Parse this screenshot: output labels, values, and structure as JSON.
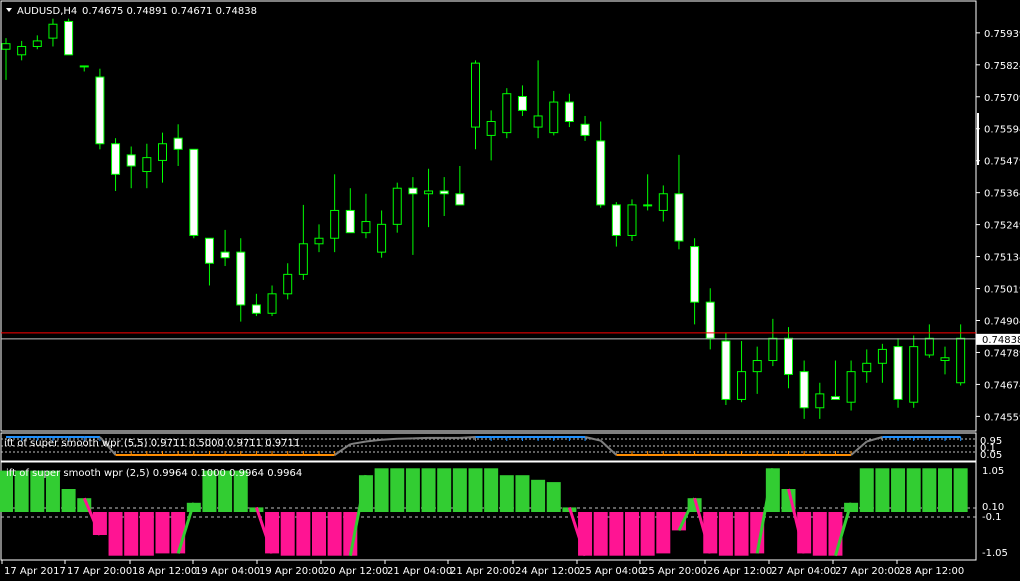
{
  "main": {
    "header": "AUDUSD,H4",
    "ohlc": "0.74675 0.74891 0.74671 0.74838",
    "y_range": [
      0.7451,
      0.7605
    ],
    "price_ticks": [
      "0.75939",
      "0.75824",
      "0.75709",
      "0.75594",
      "0.75479",
      "0.75364",
      "0.75249",
      "0.75134",
      "0.75019",
      "0.74904",
      "0.74789",
      "0.74674",
      "0.74559"
    ],
    "current_price": "0.74838",
    "colors": {
      "bull_body": "#000000",
      "bear_body": "#ffffff",
      "wick": "#00ff00",
      "price_line": "#c0c0c0",
      "red_line": "#ff0000",
      "axis": "#ffffff"
    }
  },
  "sub1": {
    "label": "ift of super smooth wpr (5,5) 0.9711 0.5000 0.9711 0.9711",
    "levels": [
      "0.95",
      "0.1",
      "0.05"
    ],
    "colors": {
      "up": "#1e90ff",
      "down": "#ff8c00",
      "neutral": "#808080"
    }
  },
  "sub2": {
    "label": "ift of super smooth wpr (2,5) 0.9964 0.1000 0.9964 0.9964",
    "levels": [
      "1.05",
      "0.10",
      "-0.1",
      "-1.05"
    ],
    "colors": {
      "up": "#32cd32",
      "down": "#ff1493"
    }
  },
  "time_axis": [
    "17 Apr 2017",
    "17 Apr 20:00",
    "18 Apr 12:00",
    "19 Apr 04:00",
    "19 Apr 20:00",
    "20 Apr 12:00",
    "21 Apr 04:00",
    "21 Apr 20:00",
    "24 Apr 12:00",
    "25 Apr 04:00",
    "25 Apr 20:00",
    "26 Apr 12:00",
    "27 Apr 04:00",
    "27 Apr 20:00",
    "28 Apr 12:00"
  ],
  "chart_data": {
    "type": "candlestick",
    "candles": [
      {
        "o": 0.7588,
        "h": 0.7592,
        "l": 0.7577,
        "c": 0.759
      },
      {
        "o": 0.7586,
        "h": 0.7591,
        "l": 0.7584,
        "c": 0.7589
      },
      {
        "o": 0.7589,
        "h": 0.7593,
        "l": 0.7588,
        "c": 0.7591
      },
      {
        "o": 0.7592,
        "h": 0.7599,
        "l": 0.7589,
        "c": 0.7597
      },
      {
        "o": 0.7598,
        "h": 0.7599,
        "l": 0.7587,
        "c": 0.7586
      },
      {
        "o": 0.7582,
        "h": 0.7582,
        "l": 0.758,
        "c": 0.7582
      },
      {
        "o": 0.7578,
        "h": 0.7581,
        "l": 0.7552,
        "c": 0.7554
      },
      {
        "o": 0.7554,
        "h": 0.7556,
        "l": 0.7537,
        "c": 0.7543
      },
      {
        "o": 0.755,
        "h": 0.7553,
        "l": 0.7538,
        "c": 0.7546
      },
      {
        "o": 0.7544,
        "h": 0.7554,
        "l": 0.7538,
        "c": 0.7549
      },
      {
        "o": 0.7548,
        "h": 0.7558,
        "l": 0.754,
        "c": 0.7554
      },
      {
        "o": 0.7556,
        "h": 0.7561,
        "l": 0.7546,
        "c": 0.7552
      },
      {
        "o": 0.7552,
        "h": 0.7552,
        "l": 0.752,
        "c": 0.7521
      },
      {
        "o": 0.752,
        "h": 0.752,
        "l": 0.7503,
        "c": 0.7511
      },
      {
        "o": 0.7515,
        "h": 0.7523,
        "l": 0.751,
        "c": 0.7513
      },
      {
        "o": 0.7515,
        "h": 0.752,
        "l": 0.749,
        "c": 0.7496
      },
      {
        "o": 0.7496,
        "h": 0.75,
        "l": 0.7492,
        "c": 0.7493
      },
      {
        "o": 0.7493,
        "h": 0.7503,
        "l": 0.7492,
        "c": 0.75
      },
      {
        "o": 0.75,
        "h": 0.7511,
        "l": 0.7498,
        "c": 0.7507
      },
      {
        "o": 0.7507,
        "h": 0.7532,
        "l": 0.7505,
        "c": 0.7518
      },
      {
        "o": 0.7518,
        "h": 0.7525,
        "l": 0.7515,
        "c": 0.752
      },
      {
        "o": 0.752,
        "h": 0.7543,
        "l": 0.7515,
        "c": 0.753
      },
      {
        "o": 0.753,
        "h": 0.7538,
        "l": 0.7525,
        "c": 0.7522
      },
      {
        "o": 0.7522,
        "h": 0.7536,
        "l": 0.752,
        "c": 0.7526
      },
      {
        "o": 0.7515,
        "h": 0.753,
        "l": 0.7513,
        "c": 0.7525
      },
      {
        "o": 0.7525,
        "h": 0.754,
        "l": 0.7522,
        "c": 0.7538
      },
      {
        "o": 0.7538,
        "h": 0.7542,
        "l": 0.7514,
        "c": 0.7536
      },
      {
        "o": 0.7536,
        "h": 0.7545,
        "l": 0.7524,
        "c": 0.7537
      },
      {
        "o": 0.7537,
        "h": 0.7542,
        "l": 0.7528,
        "c": 0.7536
      },
      {
        "o": 0.7536,
        "h": 0.7546,
        "l": 0.7532,
        "c": 0.7532
      },
      {
        "o": 0.756,
        "h": 0.7584,
        "l": 0.7552,
        "c": 0.7583
      },
      {
        "o": 0.7557,
        "h": 0.7566,
        "l": 0.7548,
        "c": 0.7562
      },
      {
        "o": 0.7558,
        "h": 0.7574,
        "l": 0.7556,
        "c": 0.7572
      },
      {
        "o": 0.7571,
        "h": 0.7575,
        "l": 0.7564,
        "c": 0.7566
      },
      {
        "o": 0.756,
        "h": 0.7584,
        "l": 0.7556,
        "c": 0.7564
      },
      {
        "o": 0.7558,
        "h": 0.7573,
        "l": 0.7557,
        "c": 0.7569
      },
      {
        "o": 0.7569,
        "h": 0.7572,
        "l": 0.756,
        "c": 0.7562
      },
      {
        "o": 0.7561,
        "h": 0.7564,
        "l": 0.7555,
        "c": 0.7557
      },
      {
        "o": 0.7555,
        "h": 0.7562,
        "l": 0.7531,
        "c": 0.7532
      },
      {
        "o": 0.7532,
        "h": 0.7533,
        "l": 0.7517,
        "c": 0.7521
      },
      {
        "o": 0.7521,
        "h": 0.7534,
        "l": 0.7519,
        "c": 0.7532
      },
      {
        "o": 0.7532,
        "h": 0.7543,
        "l": 0.753,
        "c": 0.7532
      },
      {
        "o": 0.753,
        "h": 0.7539,
        "l": 0.7526,
        "c": 0.7536
      },
      {
        "o": 0.7536,
        "h": 0.755,
        "l": 0.7516,
        "c": 0.7519
      },
      {
        "o": 0.7517,
        "h": 0.752,
        "l": 0.7489,
        "c": 0.7497
      },
      {
        "o": 0.7497,
        "h": 0.7502,
        "l": 0.748,
        "c": 0.7484
      },
      {
        "o": 0.7483,
        "h": 0.7486,
        "l": 0.746,
        "c": 0.7462
      },
      {
        "o": 0.7462,
        "h": 0.7483,
        "l": 0.7461,
        "c": 0.7472
      },
      {
        "o": 0.7472,
        "h": 0.7481,
        "l": 0.7464,
        "c": 0.7476
      },
      {
        "o": 0.7476,
        "h": 0.7491,
        "l": 0.7474,
        "c": 0.7484
      },
      {
        "o": 0.7484,
        "h": 0.7488,
        "l": 0.7466,
        "c": 0.7471
      },
      {
        "o": 0.7472,
        "h": 0.7476,
        "l": 0.7455,
        "c": 0.7459
      },
      {
        "o": 0.7459,
        "h": 0.7468,
        "l": 0.7455,
        "c": 0.7464
      },
      {
        "o": 0.7463,
        "h": 0.7476,
        "l": 0.7462,
        "c": 0.7462
      },
      {
        "o": 0.7461,
        "h": 0.7476,
        "l": 0.7458,
        "c": 0.7472
      },
      {
        "o": 0.7472,
        "h": 0.748,
        "l": 0.7468,
        "c": 0.7475
      },
      {
        "o": 0.7475,
        "h": 0.7482,
        "l": 0.7468,
        "c": 0.748
      },
      {
        "o": 0.7481,
        "h": 0.7484,
        "l": 0.7459,
        "c": 0.7462
      },
      {
        "o": 0.7461,
        "h": 0.7485,
        "l": 0.7459,
        "c": 0.7481
      },
      {
        "o": 0.7478,
        "h": 0.7489,
        "l": 0.7477,
        "c": 0.7484
      },
      {
        "o": 0.7476,
        "h": 0.7481,
        "l": 0.7471,
        "c": 0.7477
      },
      {
        "o": 0.7468,
        "h": 0.7489,
        "l": 0.7467,
        "c": 0.7484
      }
    ],
    "sub1_values": [
      1,
      1,
      1,
      1,
      1,
      1,
      1,
      -1,
      -1,
      -1,
      -1,
      -1,
      -1,
      -1,
      -1,
      -1,
      -1,
      -1,
      -1,
      -1,
      -1,
      -1,
      0.2,
      0.5,
      0.7,
      0.8,
      0.85,
      0.9,
      0.9,
      0.9,
      1,
      1,
      1,
      1,
      1,
      1,
      1,
      1,
      0.6,
      -1,
      -1,
      -1,
      -1,
      -1,
      -1,
      -1,
      -1,
      -1,
      -1,
      -1,
      -1,
      -1,
      -1,
      -1,
      -1,
      0.5,
      1,
      1,
      1,
      1,
      1,
      1
    ],
    "sub2_values": [
      0.9,
      0.9,
      0.9,
      0.9,
      0.5,
      0.3,
      -0.5,
      -0.95,
      -0.95,
      -0.95,
      -0.9,
      -0.9,
      0.2,
      0.9,
      0.9,
      0.9,
      0.1,
      -0.9,
      -0.95,
      -0.95,
      -0.95,
      -0.95,
      -0.95,
      0.8,
      0.95,
      0.95,
      0.95,
      0.95,
      0.95,
      0.95,
      0.95,
      0.95,
      0.8,
      0.8,
      0.7,
      0.65,
      0.1,
      -0.95,
      -0.95,
      -0.95,
      -0.95,
      -0.95,
      -0.9,
      -0.4,
      0.3,
      -0.9,
      -0.95,
      -0.95,
      -0.9,
      0.95,
      0.5,
      -0.9,
      -0.95,
      -0.95,
      0.2,
      0.95,
      0.95,
      0.95,
      0.95,
      0.95,
      0.95,
      0.95
    ]
  }
}
